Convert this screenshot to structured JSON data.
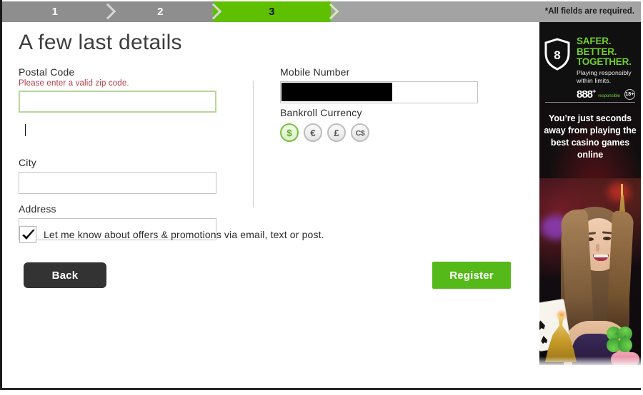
{
  "stepbar": {
    "steps": [
      {
        "label": "1",
        "state": "completed"
      },
      {
        "label": "2",
        "state": "completed"
      },
      {
        "label": "3",
        "state": "active"
      }
    ],
    "required_note": "*All fields are required.",
    "active_color": "#5ec000",
    "inactive_color": "#8e8e8e",
    "track_color": "#a3a3a3"
  },
  "main": {
    "title": "A few last details",
    "left_column": {
      "postal": {
        "label": "Postal Code",
        "error": "Please enter a valid zip code.",
        "value": "",
        "placeholder": "",
        "focused": true,
        "focus_border_color": "#b6d79b",
        "error_color": "#b33a4a"
      },
      "city": {
        "label": "City",
        "value": "",
        "placeholder": ""
      },
      "address": {
        "label": "Address",
        "value": "",
        "placeholder": ""
      }
    },
    "right_column": {
      "mobile": {
        "label": "Mobile Number",
        "value": "",
        "placeholder": "",
        "redacted": true
      },
      "currency": {
        "label": "Bankroll Currency",
        "options": [
          {
            "symbol": "$",
            "name": "usd",
            "selected": true
          },
          {
            "symbol": "€",
            "name": "eur",
            "selected": false
          },
          {
            "symbol": "£",
            "name": "gbp",
            "selected": false
          },
          {
            "symbol": "C$",
            "name": "cad",
            "selected": false
          }
        ],
        "selected_color": "#76c043"
      }
    },
    "optin": {
      "label": "Let me know about offers & promotions via email, text or post.",
      "checked": true
    },
    "buttons": {
      "back": "Back",
      "register": "Register",
      "back_color": "#333333",
      "register_color": "#55b919"
    }
  },
  "promo": {
    "headline_lines": [
      "SAFER.",
      "BETTER.",
      "TOGETHER."
    ],
    "subtext": "Playing responsibly within limits.",
    "brand": "888",
    "brand_sup": "+",
    "brand_tagline": "responsible",
    "age_badge": "18+",
    "shield_mark": "8",
    "message": "You’re just seconds away from playing the best casino games online",
    "headline_color": "#6fcf2a",
    "background_color": "#100d0e"
  }
}
